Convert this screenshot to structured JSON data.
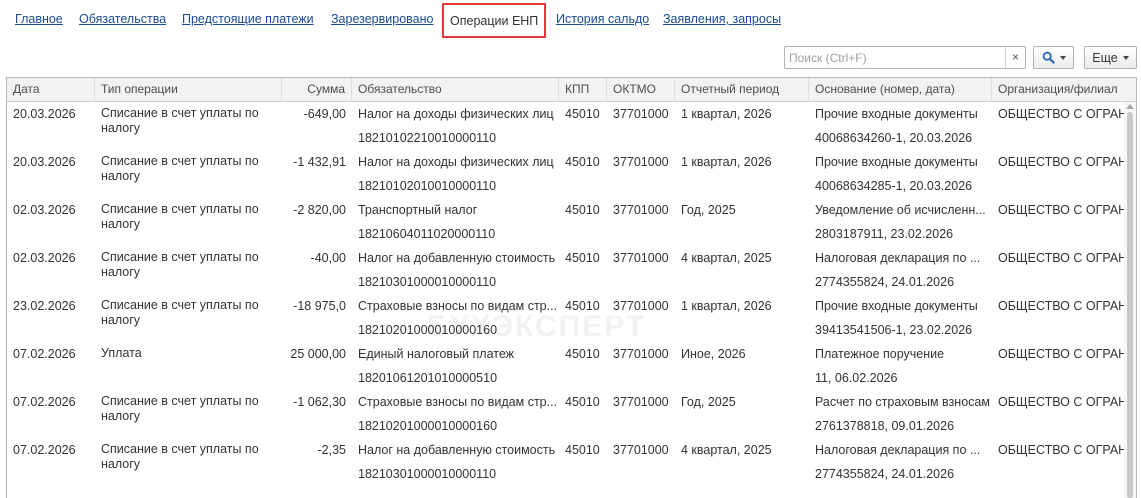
{
  "tabs": [
    {
      "label": "Главное"
    },
    {
      "label": "Обязательства"
    },
    {
      "label": "Предстоящие платежи"
    },
    {
      "label": "Зарезервировано"
    },
    {
      "label": "Операции ЕНП"
    },
    {
      "label": "История сальдо"
    },
    {
      "label": "Заявления, запросы"
    }
  ],
  "active_tab": "Операции ЕНП",
  "toolbar": {
    "search_placeholder": "Поиск (Ctrl+F)",
    "clear_label": "×",
    "more_label": "Еще"
  },
  "columns": [
    "Дата",
    "Тип операции",
    "Сумма",
    "Обязательство",
    "КПП",
    "ОКТМО",
    "Отчетный период",
    "Основание (номер, дата)",
    "Организация/филиал"
  ],
  "rows": [
    {
      "date": "20.03.2026",
      "type": "Списание в счет уплаты по налогу",
      "sum": "-649,00",
      "obligation": "Налог на доходы физических лиц",
      "kbk": "18210102210010000110",
      "kpp": "45010",
      "oktmo": "37701000",
      "period": "1 квартал, 2026",
      "basis1": "Прочие входные документы",
      "basis2": "40068634260-1, 20.03.2026",
      "org": "ОБЩЕСТВО С ОГРАНИ"
    },
    {
      "date": "20.03.2026",
      "type": "Списание в счет уплаты по налогу",
      "sum": "-1 432,91",
      "obligation": "Налог на доходы физических лиц",
      "kbk": "18210102010010000110",
      "kpp": "45010",
      "oktmo": "37701000",
      "period": "1 квартал, 2026",
      "basis1": "Прочие входные документы",
      "basis2": "40068634285-1, 20.03.2026",
      "org": "ОБЩЕСТВО С ОГРАНИ"
    },
    {
      "date": "02.03.2026",
      "type": "Списание в счет уплаты по налогу",
      "sum": "-2 820,00",
      "obligation": "Транспортный налог",
      "kbk": "18210604011020000110",
      "kpp": "45010",
      "oktmo": "37701000",
      "period": "Год, 2025",
      "basis1": "Уведомление об исчисленн...",
      "basis2": "2803187911, 23.02.2026",
      "org": "ОБЩЕСТВО С ОГРАНИ"
    },
    {
      "date": "02.03.2026",
      "type": "Списание в счет уплаты по налогу",
      "sum": "-40,00",
      "obligation": "Налог на добавленную стоимость",
      "kbk": "18210301000010000110",
      "kpp": "45010",
      "oktmo": "37701000",
      "period": "4 квартал, 2025",
      "basis1": "Налоговая декларация по ...",
      "basis2": "2774355824, 24.01.2026",
      "org": "ОБЩЕСТВО С ОГРАНИ"
    },
    {
      "date": "23.02.2026",
      "type": "Списание в счет уплаты по налогу",
      "sum": "-18 975,0",
      "obligation": "Страховые взносы по видам стр...",
      "kbk": "18210201000010000160",
      "kpp": "45010",
      "oktmo": "37701000",
      "period": "1 квартал, 2026",
      "basis1": "Прочие входные документы",
      "basis2": "39413541506-1, 23.02.2026",
      "org": "ОБЩЕСТВО С ОГРАНИ"
    },
    {
      "date": "07.02.2026",
      "type": "Уплата",
      "sum": "25 000,00",
      "obligation": "Единый налоговый платеж",
      "kbk": "18201061201010000510",
      "kpp": "45010",
      "oktmo": "37701000",
      "period": "Иное, 2026",
      "basis1": "Платежное поручение",
      "basis2": "11, 06.02.2026",
      "org": "ОБЩЕСТВО С ОГРАНИ"
    },
    {
      "date": "07.02.2026",
      "type": "Списание в счет уплаты по налогу",
      "sum": "-1 062,30",
      "obligation": "Страховые взносы по видам стр...",
      "kbk": "18210201000010000160",
      "kpp": "45010",
      "oktmo": "37701000",
      "period": "Год, 2025",
      "basis1": "Расчет по страховым взносам",
      "basis2": "2761378818, 09.01.2026",
      "org": "ОБЩЕСТВО С ОГРАНИ"
    },
    {
      "date": "07.02.2026",
      "type": "Списание в счет уплаты по налогу",
      "sum": "-2,35",
      "obligation": "Налог на добавленную стоимость",
      "kbk": "18210301000010000110",
      "kpp": "45010",
      "oktmo": "37701000",
      "period": "4 квартал, 2025",
      "basis1": "Налоговая декларация по ...",
      "basis2": "2774355824, 24.01.2026",
      "org": "ОБЩЕСТВО С ОГРАНИ"
    }
  ],
  "watermark": "БУХЭКСПЕРТ"
}
